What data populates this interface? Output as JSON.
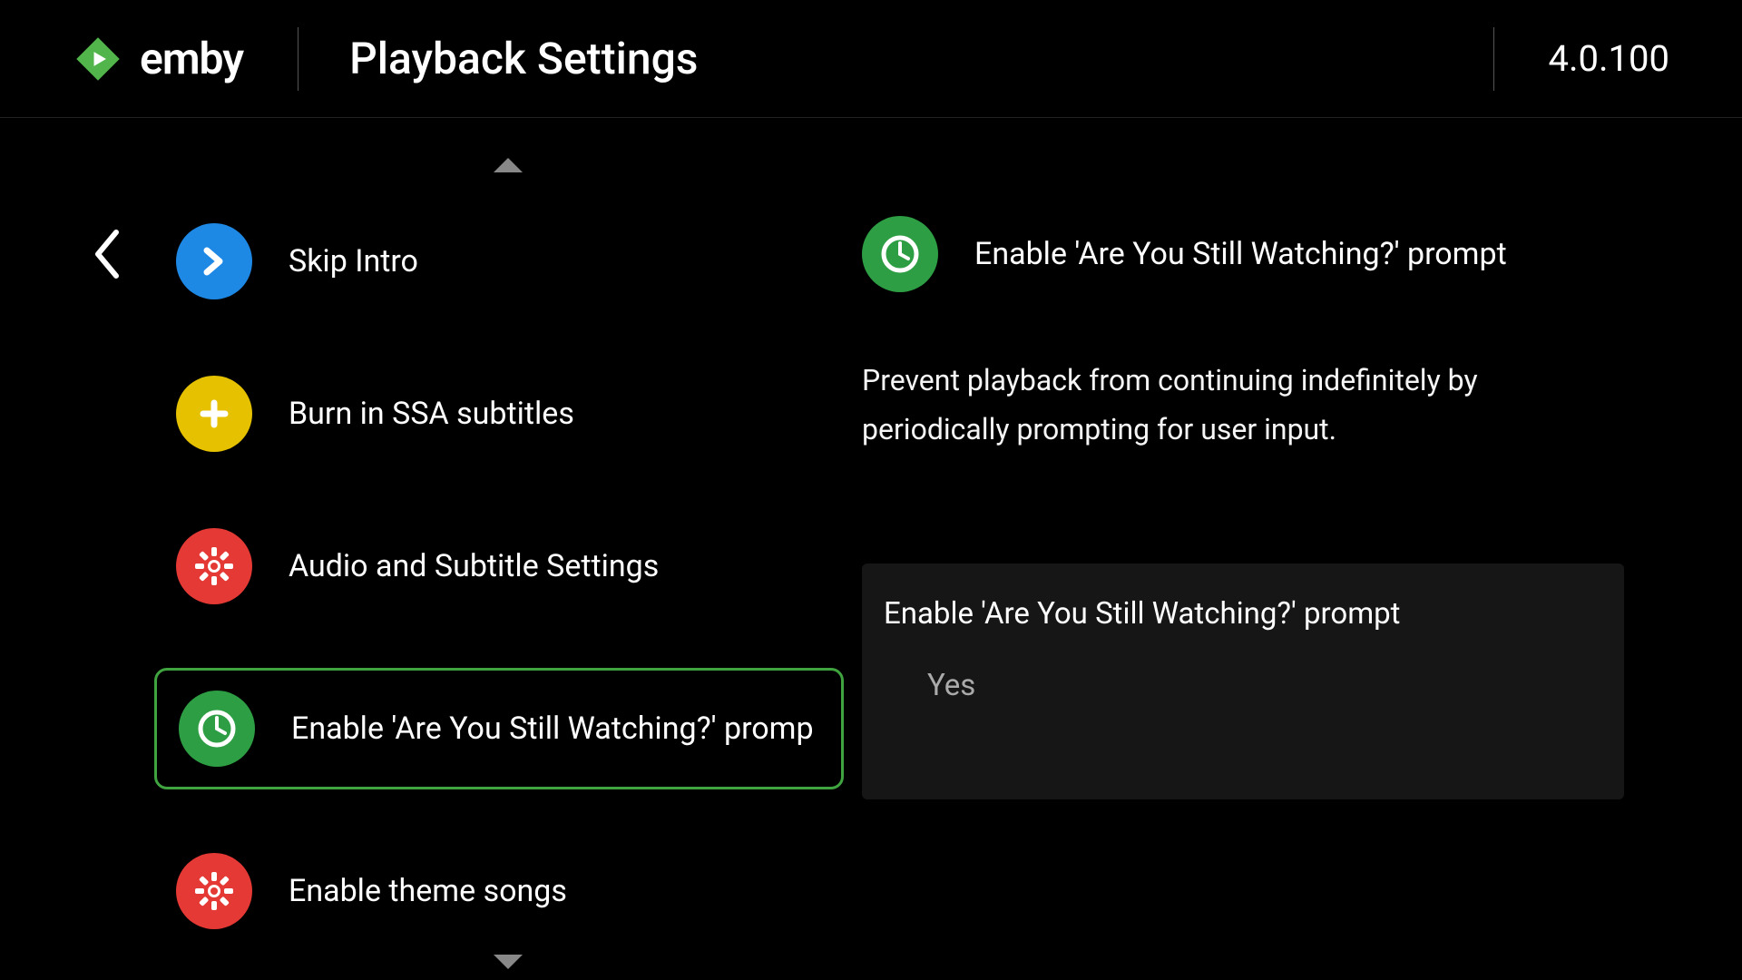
{
  "header": {
    "logo_text": "emby",
    "page_title": "Playback Settings",
    "version": "4.0.100"
  },
  "menu": {
    "items": [
      {
        "label": "Skip Intro"
      },
      {
        "label": "Burn in SSA subtitles"
      },
      {
        "label": "Audio and Subtitle Settings"
      },
      {
        "label": "Enable 'Are You Still Watching?' promp"
      },
      {
        "label": "Enable theme songs"
      }
    ]
  },
  "detail": {
    "title": "Enable 'Are You Still Watching?' prompt",
    "description": "Prevent playback from continuing indefinitely by periodically prompting for user input."
  },
  "setting": {
    "title": "Enable 'Are You Still Watching?' prompt",
    "value": "Yes"
  },
  "colors": {
    "brand_green": "#52b54b",
    "select_border": "#3fa33f"
  }
}
